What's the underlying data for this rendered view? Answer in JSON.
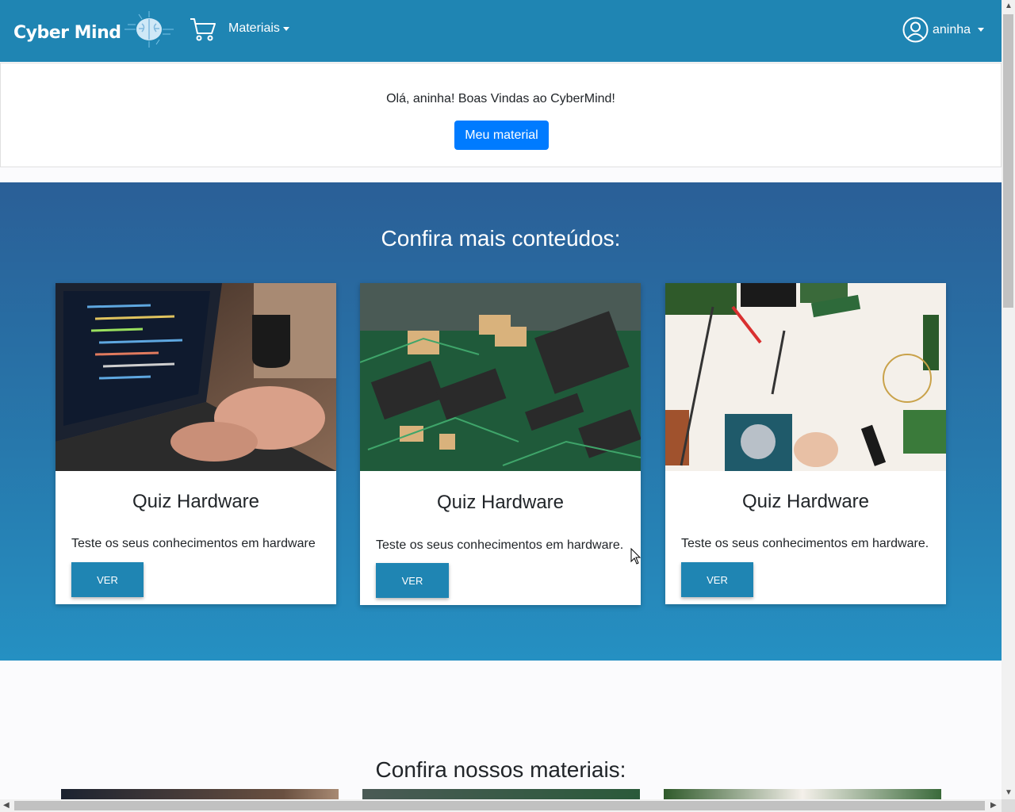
{
  "navbar": {
    "brand": "Cyber Mind",
    "materials_menu": "Materiais",
    "username": "aninha"
  },
  "welcome": {
    "message": "Olá, aninha! Boas Vindas ao CyberMind!",
    "button": "Meu material"
  },
  "more_content": {
    "title": "Confira mais conteúdos:",
    "cards": [
      {
        "title": "Quiz Hardware",
        "description": "Teste os seus conhecimentos em hardware",
        "button": "VER"
      },
      {
        "title": "Quiz Hardware",
        "description": "Teste os seus conhecimentos em hardware.",
        "button": "VER"
      },
      {
        "title": "Quiz Hardware",
        "description": "Teste os seus conhecimentos em hardware.",
        "button": "VER"
      }
    ]
  },
  "materials": {
    "title": "Confira nossos materiais:"
  },
  "colors": {
    "navbar": "#1f85b3",
    "primary_button": "#007bff",
    "card_button": "#1f85b3",
    "section_gradient_top": "#2a5f97",
    "section_gradient_bottom": "#2590c2"
  },
  "icons": [
    "brain-icon",
    "cart-icon",
    "user-circle-icon"
  ]
}
